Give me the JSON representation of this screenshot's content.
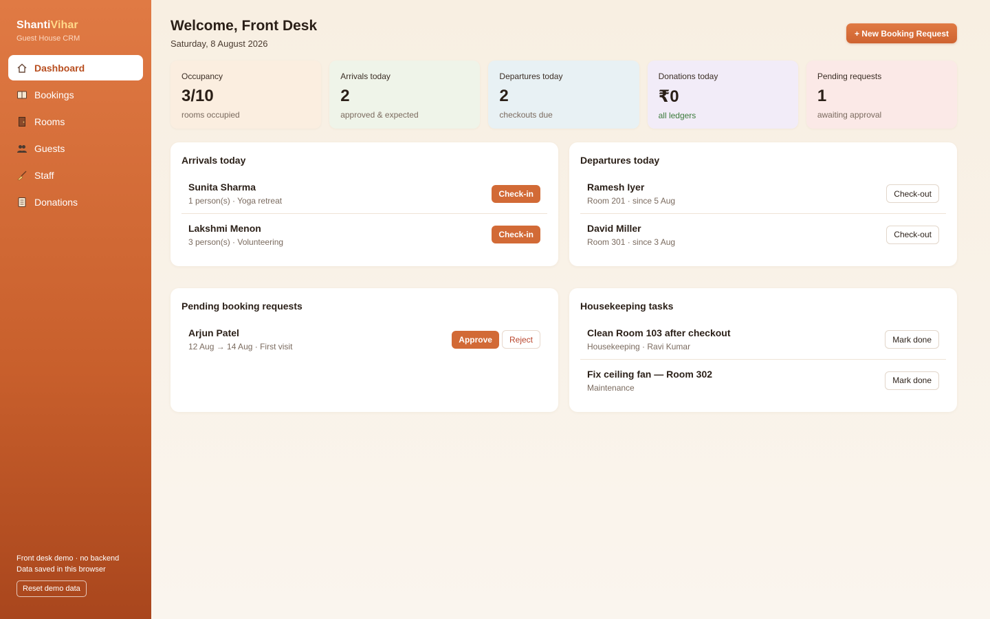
{
  "brand": {
    "name_part1": "Shanti",
    "name_part2": "Vihar",
    "subtitle": "Guest House CRM"
  },
  "nav": [
    {
      "label": "Dashboard",
      "icon": "home-icon",
      "glyph": "⌂",
      "active": true
    },
    {
      "label": "Bookings",
      "icon": "book-icon",
      "glyph": "📖",
      "active": false
    },
    {
      "label": "Rooms",
      "icon": "door-icon",
      "glyph": "🚪",
      "active": false
    },
    {
      "label": "Guests",
      "icon": "people-icon",
      "glyph": "👥",
      "active": false
    },
    {
      "label": "Staff",
      "icon": "broom-icon",
      "glyph": "🧹",
      "active": false
    },
    {
      "label": "Donations",
      "icon": "ledger-icon",
      "glyph": "📒",
      "active": false
    }
  ],
  "footer": {
    "line1": "Front desk demo · no backend",
    "line2": "Data saved in this browser",
    "reset_label": "Reset demo data"
  },
  "header": {
    "title": "Welcome, Front Desk",
    "date": "Saturday, 8 August 2026",
    "new_booking_label": "+ New Booking Request"
  },
  "stats": [
    {
      "label": "Occupancy",
      "value": "3/10",
      "sub": "rooms occupied"
    },
    {
      "label": "Arrivals today",
      "value": "2",
      "sub": "approved & expected"
    },
    {
      "label": "Departures today",
      "value": "2",
      "sub": "checkouts due"
    },
    {
      "label": "Donations today",
      "value": "₹0",
      "sub": "all ledgers"
    },
    {
      "label": "Pending requests",
      "value": "1",
      "sub": "awaiting approval"
    }
  ],
  "arrivals": {
    "title": "Arrivals today",
    "action_label": "Check-in",
    "items": [
      {
        "name": "Sunita Sharma",
        "detail": "1 person(s) · Yoga retreat"
      },
      {
        "name": "Lakshmi Menon",
        "detail": "3 person(s) · Volunteering"
      }
    ]
  },
  "departures": {
    "title": "Departures today",
    "action_label": "Check-out",
    "items": [
      {
        "name": "Ramesh Iyer",
        "detail": "Room 201 · since 5 Aug"
      },
      {
        "name": "David Miller",
        "detail": "Room 301 · since 3 Aug"
      }
    ]
  },
  "pending": {
    "title": "Pending booking requests",
    "approve_label": "Approve",
    "reject_label": "Reject",
    "items": [
      {
        "name": "Arjun Patel",
        "detail": "12 Aug → 14 Aug · First visit"
      }
    ]
  },
  "housekeeping": {
    "title": "Housekeeping tasks",
    "action_label": "Mark done",
    "items": [
      {
        "name": "Clean Room 103 after checkout",
        "detail": "Housekeeping · Ravi Kumar"
      },
      {
        "name": "Fix ceiling fan — Room 302",
        "detail": "Maintenance"
      }
    ]
  }
}
